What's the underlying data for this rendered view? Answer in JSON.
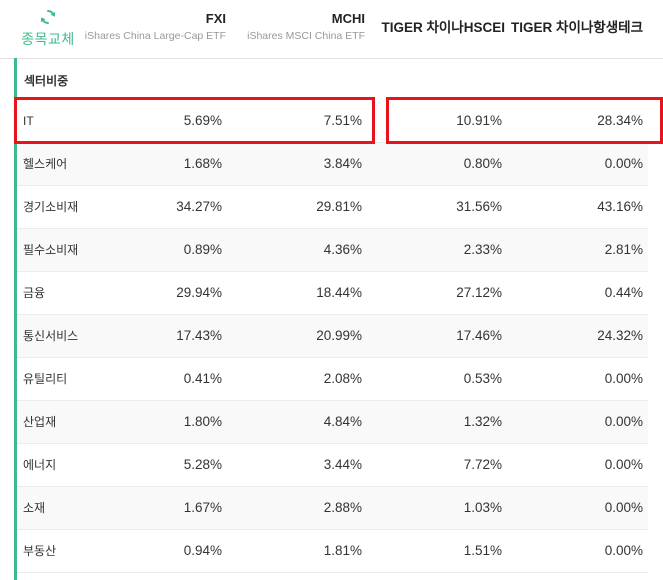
{
  "swap_button": {
    "label": "종목교체",
    "icon": "swap-arrows-icon"
  },
  "columns": [
    {
      "ticker": "FXI",
      "name": "iShares China Large-Cap ETF"
    },
    {
      "ticker": "MCHI",
      "name": "iShares MSCI China ETF"
    },
    {
      "ticker": "TIGER 차이나HSCEI",
      "name": ""
    },
    {
      "ticker": "TIGER 차이나항생테크",
      "name": ""
    }
  ],
  "section_title": "섹터비중",
  "rows": [
    {
      "label": "IT",
      "values": [
        "5.69%",
        "7.51%",
        "10.91%",
        "28.34%"
      ]
    },
    {
      "label": "헬스케어",
      "values": [
        "1.68%",
        "3.84%",
        "0.80%",
        "0.00%"
      ]
    },
    {
      "label": "경기소비재",
      "values": [
        "34.27%",
        "29.81%",
        "31.56%",
        "43.16%"
      ]
    },
    {
      "label": "필수소비재",
      "values": [
        "0.89%",
        "4.36%",
        "2.33%",
        "2.81%"
      ]
    },
    {
      "label": "금융",
      "values": [
        "29.94%",
        "18.44%",
        "27.12%",
        "0.44%"
      ]
    },
    {
      "label": "통신서비스",
      "values": [
        "17.43%",
        "20.99%",
        "17.46%",
        "24.32%"
      ]
    },
    {
      "label": "유틸리티",
      "values": [
        "0.41%",
        "2.08%",
        "0.53%",
        "0.00%"
      ]
    },
    {
      "label": "산업재",
      "values": [
        "1.80%",
        "4.84%",
        "1.32%",
        "0.00%"
      ]
    },
    {
      "label": "에너지",
      "values": [
        "5.28%",
        "3.44%",
        "7.72%",
        "0.00%"
      ]
    },
    {
      "label": "소재",
      "values": [
        "1.67%",
        "2.88%",
        "1.03%",
        "0.00%"
      ]
    },
    {
      "label": "부동산",
      "values": [
        "0.94%",
        "1.81%",
        "1.51%",
        "0.00%"
      ]
    }
  ],
  "colors": {
    "accent": "#3dbb8a",
    "highlight": "#e8141b"
  }
}
